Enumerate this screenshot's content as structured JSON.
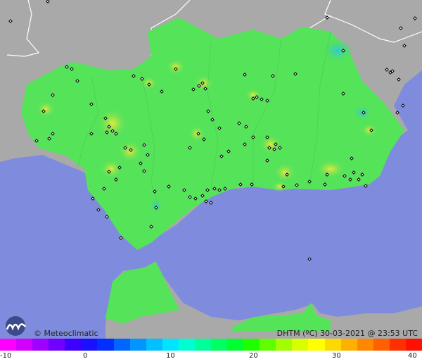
{
  "header": {
    "credit": "© Meteoclimatic",
    "title": "DHTM (ºC)  30-03-2021 @ 23:53 UTC"
  },
  "legend": {
    "tick_labels": [
      "-10",
      "0",
      "10",
      "20",
      "30",
      "40"
    ],
    "min": -10,
    "max": 40,
    "colors": [
      "#ff00ff",
      "#d400ff",
      "#a000ff",
      "#7000ff",
      "#3e00ff",
      "#1a10ff",
      "#0030ff",
      "#0066ff",
      "#0095ff",
      "#00c0ff",
      "#00e5ff",
      "#00ffd0",
      "#00ff98",
      "#00ff60",
      "#00ff30",
      "#20ff00",
      "#60ff00",
      "#a0ff00",
      "#d8ff00",
      "#ffff00",
      "#ffd800",
      "#ffb000",
      "#ff8800",
      "#ff6000",
      "#ff3000",
      "#ff1000"
    ]
  },
  "map_colors": {
    "sea": "#7f8bdc",
    "land_outside": "#a9a9a9",
    "region_fill": "#55e35a",
    "warm_spot": "#c8e83a",
    "cool_spot": "#3ad6b4",
    "station": "#000000"
  }
}
